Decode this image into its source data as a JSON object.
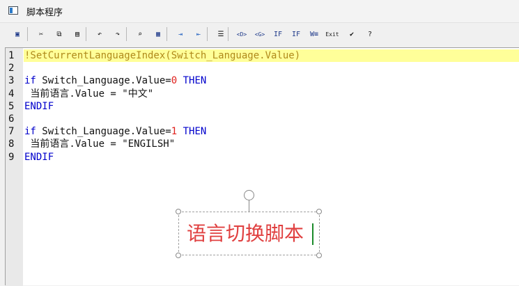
{
  "window": {
    "title": "脚本程序"
  },
  "toolbar": {
    "buttons": [
      {
        "name": "save-icon",
        "glyph": "▣",
        "color": "#1f3a8a"
      },
      {
        "name": "cut-icon",
        "glyph": "✂",
        "color": "#111111"
      },
      {
        "name": "copy-icon",
        "glyph": "⧉",
        "color": "#111111"
      },
      {
        "name": "paste-icon",
        "glyph": "▤",
        "color": "#111111"
      },
      {
        "name": "undo-icon",
        "glyph": "↶",
        "color": "#111111"
      },
      {
        "name": "redo-icon",
        "glyph": "↷",
        "color": "#111111"
      },
      {
        "name": "find-icon",
        "glyph": "⌕",
        "color": "#111111"
      },
      {
        "name": "replace-icon",
        "glyph": "▦",
        "color": "#1f3a8a"
      },
      {
        "name": "import-icon",
        "glyph": "⇥",
        "color": "#1f5fbf"
      },
      {
        "name": "export-icon",
        "glyph": "⇤",
        "color": "#1f5fbf"
      },
      {
        "name": "comment-icon",
        "glyph": "☰",
        "color": "#111111"
      },
      {
        "name": "insert-d-icon",
        "glyph": "<D>",
        "color": "#1f3a8a"
      },
      {
        "name": "insert-g-icon",
        "glyph": "<G>",
        "color": "#1f3a8a"
      },
      {
        "name": "if-icon",
        "glyph": "IF",
        "color": "#1f3a8a"
      },
      {
        "name": "if-else-icon",
        "glyph": "IF",
        "color": "#1f3a8a"
      },
      {
        "name": "while-icon",
        "glyph": "W≡",
        "color": "#1f3a8a"
      },
      {
        "name": "exit-icon",
        "glyph": "Exit",
        "color": "#1a1a1a"
      },
      {
        "name": "check-icon",
        "glyph": "✔",
        "color": "#111111"
      },
      {
        "name": "help-icon",
        "glyph": "?",
        "color": "#111111"
      }
    ]
  },
  "code": {
    "lines": [
      {
        "num": "1",
        "highlight": true,
        "tokens": [
          {
            "t": "!SetCurrentLanguageIndex(Switch_Language.Value)",
            "c": "comment"
          }
        ]
      },
      {
        "num": "2",
        "tokens": []
      },
      {
        "num": "3",
        "tokens": [
          {
            "t": "if",
            "c": "kw"
          },
          {
            "t": " Switch_Language.Value=",
            "c": ""
          },
          {
            "t": "0",
            "c": "num"
          },
          {
            "t": " ",
            "c": ""
          },
          {
            "t": "THEN",
            "c": "kw"
          }
        ]
      },
      {
        "num": "4",
        "tokens": [
          {
            "t": " 当前语言.Value = \"中文\"",
            "c": ""
          }
        ]
      },
      {
        "num": "5",
        "tokens": [
          {
            "t": "ENDIF",
            "c": "kw"
          }
        ]
      },
      {
        "num": "6",
        "tokens": []
      },
      {
        "num": "7",
        "tokens": [
          {
            "t": "if",
            "c": "kw"
          },
          {
            "t": " Switch_Language.Value=",
            "c": ""
          },
          {
            "t": "1",
            "c": "num"
          },
          {
            "t": " ",
            "c": ""
          },
          {
            "t": "THEN",
            "c": "kw"
          }
        ]
      },
      {
        "num": "8",
        "tokens": [
          {
            "t": " 当前语言.Value = \"ENGILSH\"",
            "c": ""
          }
        ]
      },
      {
        "num": "9",
        "tokens": [
          {
            "t": "ENDIF",
            "c": "kw"
          }
        ]
      }
    ]
  },
  "overlay": {
    "text": "语言切换脚本"
  }
}
